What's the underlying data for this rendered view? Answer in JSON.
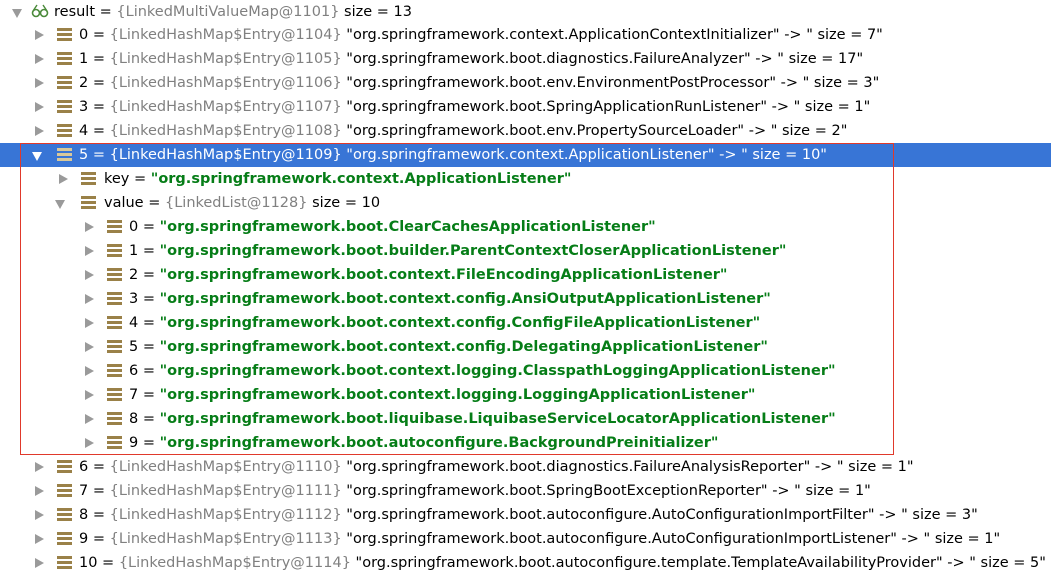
{
  "root": {
    "name": "result",
    "value": "{LinkedMultiValueMap@1101}",
    "size": "size = 13"
  },
  "entries_before": [
    {
      "idx": "0 = ",
      "obj": "{LinkedHashMap$Entry@1104}",
      "text": " \"org.springframework.context.ApplicationContextInitializer\" -> \" size = 7\""
    },
    {
      "idx": "1 = ",
      "obj": "{LinkedHashMap$Entry@1105}",
      "text": " \"org.springframework.boot.diagnostics.FailureAnalyzer\" -> \" size = 17\""
    },
    {
      "idx": "2 = ",
      "obj": "{LinkedHashMap$Entry@1106}",
      "text": " \"org.springframework.boot.env.EnvironmentPostProcessor\" -> \" size = 3\""
    },
    {
      "idx": "3 = ",
      "obj": "{LinkedHashMap$Entry@1107}",
      "text": " \"org.springframework.boot.SpringApplicationRunListener\" -> \" size = 1\""
    },
    {
      "idx": "4 = ",
      "obj": "{LinkedHashMap$Entry@1108}",
      "text": " \"org.springframework.boot.env.PropertySourceLoader\" -> \" size = 2\""
    }
  ],
  "selected_entry": {
    "idx": "5 = ",
    "obj": "{LinkedHashMap$Entry@1109}",
    "text": " \"org.springframework.context.ApplicationListener\" -> \" size = 10\""
  },
  "key_node": {
    "name": "key",
    "eq": " = ",
    "value": "\"org.springframework.context.ApplicationListener\""
  },
  "value_node": {
    "name": "value",
    "eq": " = ",
    "obj": "{LinkedList@1128}",
    "size": "  size = 10"
  },
  "listeners": [
    {
      "idx": "0 = ",
      "value": "\"org.springframework.boot.ClearCachesApplicationListener\""
    },
    {
      "idx": "1 = ",
      "value": "\"org.springframework.boot.builder.ParentContextCloserApplicationListener\""
    },
    {
      "idx": "2 = ",
      "value": "\"org.springframework.boot.context.FileEncodingApplicationListener\""
    },
    {
      "idx": "3 = ",
      "value": "\"org.springframework.boot.context.config.AnsiOutputApplicationListener\""
    },
    {
      "idx": "4 = ",
      "value": "\"org.springframework.boot.context.config.ConfigFileApplicationListener\""
    },
    {
      "idx": "5 = ",
      "value": "\"org.springframework.boot.context.config.DelegatingApplicationListener\""
    },
    {
      "idx": "6 = ",
      "value": "\"org.springframework.boot.context.logging.ClasspathLoggingApplicationListener\""
    },
    {
      "idx": "7 = ",
      "value": "\"org.springframework.boot.context.logging.LoggingApplicationListener\""
    },
    {
      "idx": "8 = ",
      "value": "\"org.springframework.boot.liquibase.LiquibaseServiceLocatorApplicationListener\""
    },
    {
      "idx": "9 = ",
      "value": "\"org.springframework.boot.autoconfigure.BackgroundPreinitializer\""
    }
  ],
  "entries_after": [
    {
      "idx": "6 = ",
      "obj": "{LinkedHashMap$Entry@1110}",
      "text": " \"org.springframework.boot.diagnostics.FailureAnalysisReporter\" -> \" size = 1\""
    },
    {
      "idx": "7 = ",
      "obj": "{LinkedHashMap$Entry@1111}",
      "text": " \"org.springframework.boot.SpringBootExceptionReporter\" -> \" size = 1\""
    },
    {
      "idx": "8 = ",
      "obj": "{LinkedHashMap$Entry@1112}",
      "text": " \"org.springframework.boot.autoconfigure.AutoConfigurationImportFilter\" -> \" size = 3\""
    },
    {
      "idx": "9 = ",
      "obj": "{LinkedHashMap$Entry@1113}",
      "text": " \"org.springframework.boot.autoconfigure.AutoConfigurationImportListener\" -> \" size = 1\""
    },
    {
      "idx": "10 = ",
      "obj": "{LinkedHashMap$Entry@1114}",
      "text": " \"org.springframework.boot.autoconfigure.template.TemplateAvailabilityProvider\" -> \" size = 5\""
    }
  ],
  "colors": {
    "selection": "#3875d6",
    "string": "#067d17",
    "object": "#808080",
    "highlight_box": "#e0392b"
  }
}
